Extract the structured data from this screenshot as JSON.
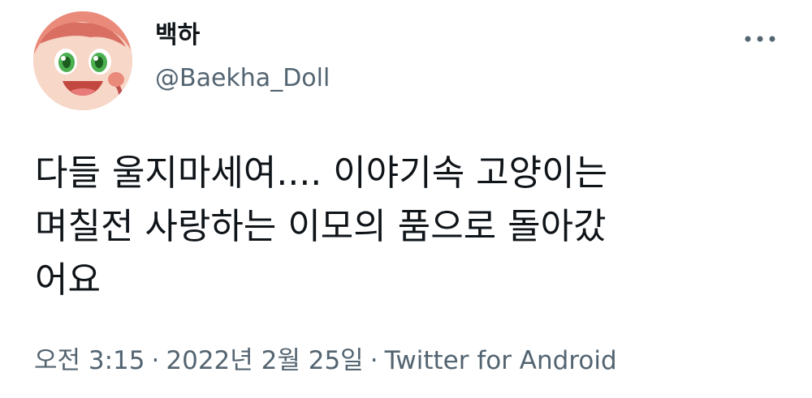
{
  "author": {
    "display_name": "백하",
    "handle": "@Baekha_Doll",
    "avatar_icon": "anime-character-avatar-icon"
  },
  "more_icon": "more-horizontal-icon",
  "tweet": {
    "text": "다들 울지마세여.... 이야기속 고양이는\n며칠전 사랑하는 이모의 품으로 돌아갔\n어요"
  },
  "meta": {
    "time": "오전 3:15",
    "separator": "·",
    "date": "2022년 2월 25일",
    "source": "Twitter for Android"
  },
  "colors": {
    "text_primary": "#0f1419",
    "text_secondary": "#536471"
  }
}
